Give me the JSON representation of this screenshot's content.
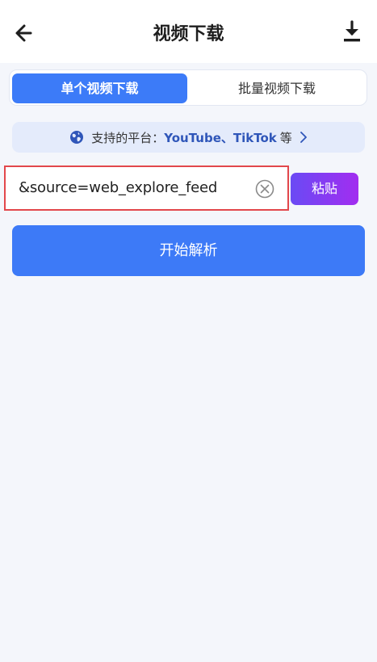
{
  "header": {
    "title": "视频下载",
    "back_icon": "arrow-left-icon",
    "download_icon": "download-icon"
  },
  "tabs": [
    {
      "label": "单个视频下载",
      "active": true
    },
    {
      "label": "批量视频下载",
      "active": false
    }
  ],
  "platform_notice": {
    "icon": "globe-icon",
    "prefix": "支持的平台：",
    "platforms": "YouTube、TikTok",
    "suffix": "等",
    "chevron_icon": "chevron-right-icon"
  },
  "url_input": {
    "value": "&source=web_explore_feed",
    "clear_icon": "clear-circle-icon"
  },
  "paste_button": {
    "label": "粘贴"
  },
  "parse_button": {
    "label": "开始解析"
  },
  "colors": {
    "accent": "#3c7bf8",
    "highlight_border": "#e2474b",
    "paste_gradient_start": "#6a4af4",
    "paste_gradient_end": "#a22df0",
    "notice_bg": "#e4ebfb",
    "notice_brand": "#2f56b9"
  }
}
